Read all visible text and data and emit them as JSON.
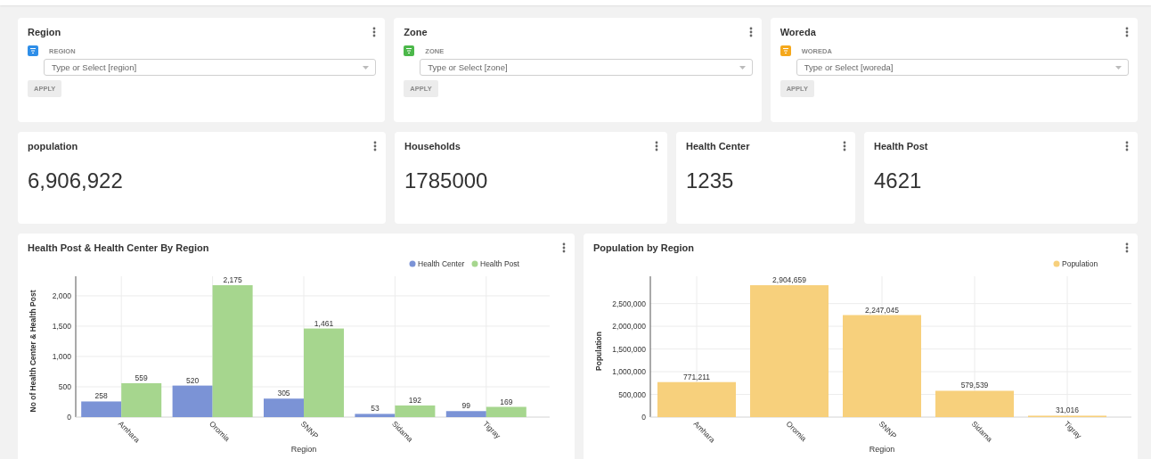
{
  "filters": [
    {
      "title": "Region",
      "label": "REGION",
      "placeholder": "Type or Select [region]",
      "color": "#2e8ee8",
      "apply": {
        "label": "APPLY",
        "disabled": true
      }
    },
    {
      "title": "Zone",
      "label": "ZONE",
      "placeholder": "Type or Select [zone]",
      "color": "#4cb84a",
      "apply": {
        "label": "APPLY",
        "disabled": true
      }
    },
    {
      "title": "Woreda",
      "label": "WOREDA",
      "placeholder": "Type or Select [woreda]",
      "color": "#f5a81c",
      "apply": {
        "label": "APPLY",
        "disabled": true
      }
    }
  ],
  "kpis": [
    {
      "title": "population",
      "value": "6,906,922"
    },
    {
      "title": "Households",
      "value": "1785000"
    },
    {
      "title": "Health Center",
      "value": "1235"
    },
    {
      "title": "Health Post",
      "value": "4621"
    }
  ],
  "charts": [
    {
      "title": "Health Post & Health Center By Region",
      "chart_data": {
        "type": "bar",
        "xlabel": "Region",
        "ylabel": "No of Health Center & Health Post",
        "categories": [
          "Amhara",
          "Oromia",
          "SNNP",
          "Sidama",
          "Tigray"
        ],
        "series": [
          {
            "name": "Health Center",
            "color": "#7b93d6",
            "values": [
              258,
              520,
              305,
              53,
              99
            ]
          },
          {
            "name": "Health Post",
            "color": "#a6d68e",
            "values": [
              559,
              2175,
              1461,
              192,
              169
            ]
          }
        ],
        "value_labels": [
          [
            "258",
            "520",
            "305",
            "53",
            "99"
          ],
          [
            "559",
            "2,175",
            "1,461",
            "192",
            "169"
          ]
        ],
        "grid": true,
        "legend": true,
        "ylim": [
          0,
          2175
        ],
        "yticks": [
          {
            "value": 0,
            "label": "0"
          },
          {
            "value": 500,
            "label": "500"
          },
          {
            "value": 1000,
            "label": "1,000"
          },
          {
            "value": 1500,
            "label": "1,500"
          },
          {
            "value": 2000,
            "label": "2,000"
          }
        ]
      }
    },
    {
      "title": "Population by Region",
      "chart_data": {
        "type": "bar",
        "xlabel": "Region",
        "ylabel": "Population",
        "categories": [
          "Amhara",
          "Oromia",
          "SNNP",
          "Sidama",
          "Tigray"
        ],
        "series": [
          {
            "name": "Population",
            "color": "#f7d07c",
            "values": [
              771211,
              2904659,
              2247045,
              579539,
              31016
            ]
          }
        ],
        "value_labels": [
          [
            "771,211",
            "2,904,659",
            "2,247,045",
            "579,539",
            "31,016"
          ]
        ],
        "grid": true,
        "legend": true,
        "ylim": [
          0,
          2904659
        ],
        "yticks": [
          {
            "value": 0,
            "label": "0"
          },
          {
            "value": 500000,
            "label": "500,000"
          },
          {
            "value": 1000000,
            "label": "1,000,000"
          },
          {
            "value": 1500000,
            "label": "1,500,000"
          },
          {
            "value": 2000000,
            "label": "2,000,000"
          },
          {
            "value": 2500000,
            "label": "2,500,000"
          }
        ]
      }
    }
  ]
}
